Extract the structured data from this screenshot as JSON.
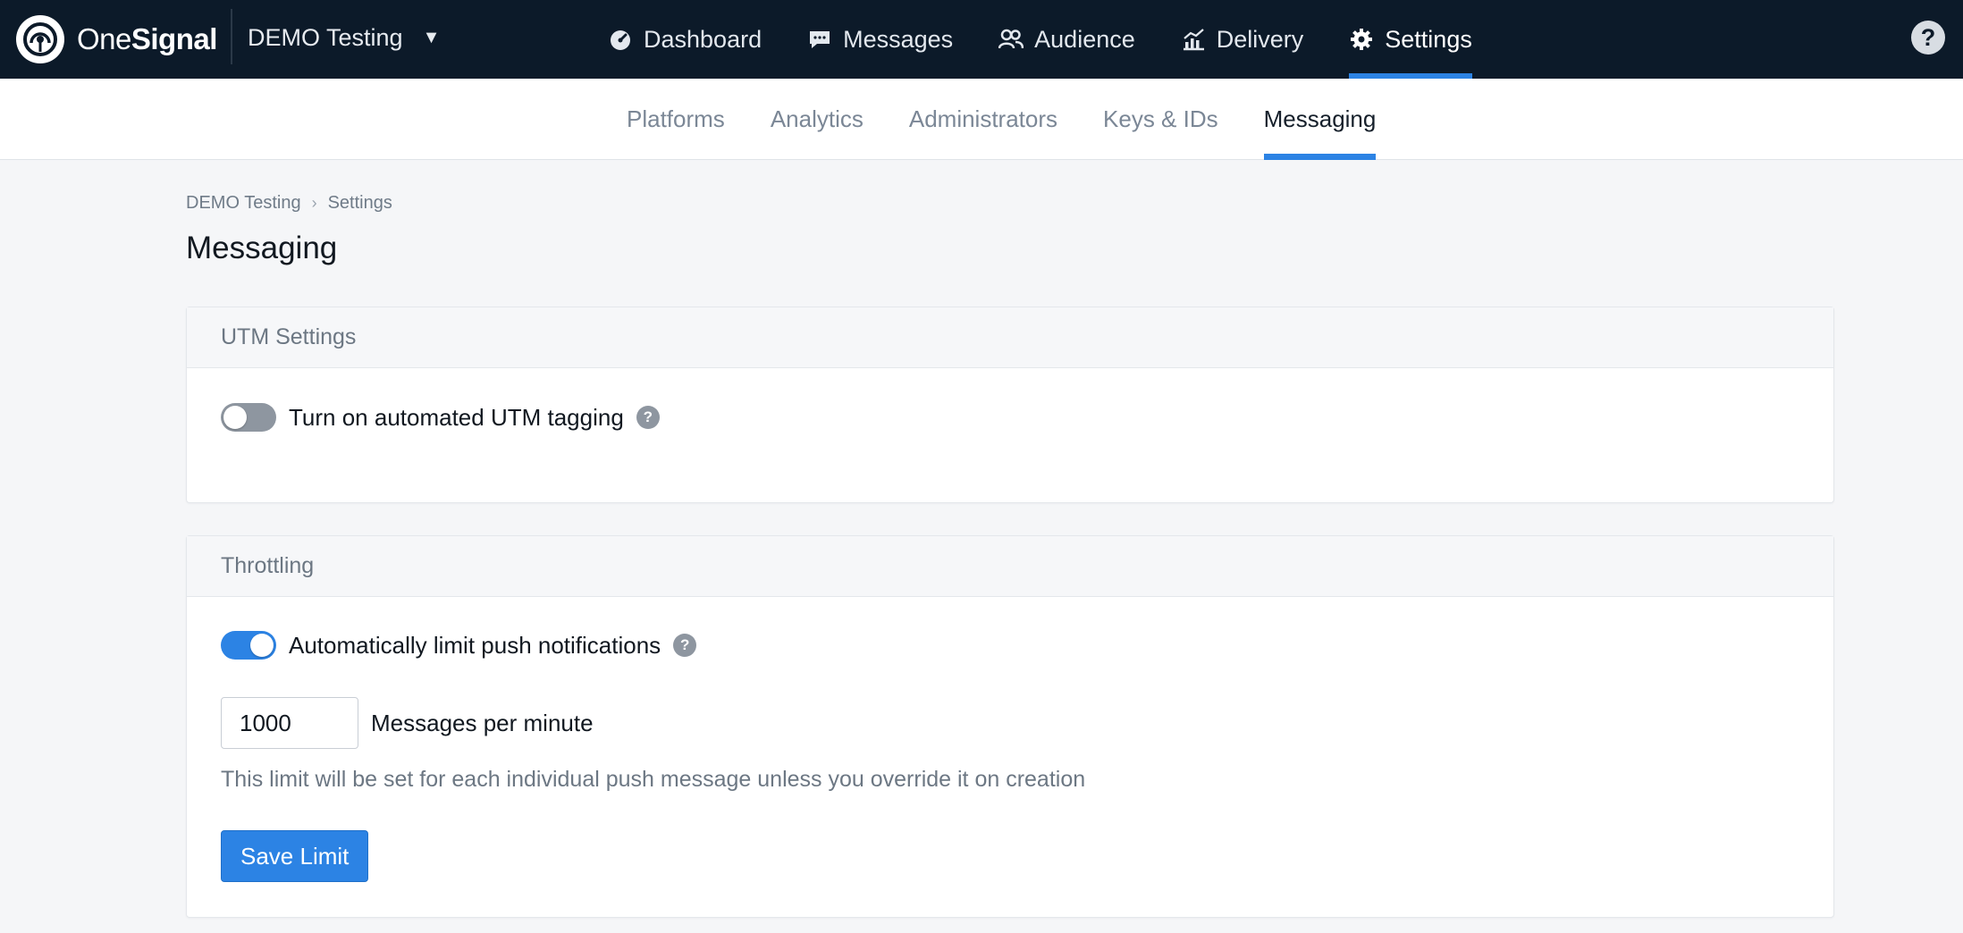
{
  "brand": {
    "name_part1": "One",
    "name_part2": "Signal",
    "logo_icon": "onesignal-logo-icon"
  },
  "app_switcher": {
    "label": "DEMO Testing",
    "caret": "▼"
  },
  "main_nav": {
    "items": [
      {
        "label": "Dashboard",
        "icon": "gauge-icon",
        "active": false
      },
      {
        "label": "Messages",
        "icon": "chat-bubble-icon",
        "active": false
      },
      {
        "label": "Audience",
        "icon": "users-icon",
        "active": false
      },
      {
        "label": "Delivery",
        "icon": "chart-icon",
        "active": false
      },
      {
        "label": "Settings",
        "icon": "gear-icon",
        "active": true
      }
    ]
  },
  "help": {
    "label": "?"
  },
  "sub_nav": {
    "items": [
      {
        "label": "Platforms",
        "active": false
      },
      {
        "label": "Analytics",
        "active": false
      },
      {
        "label": "Administrators",
        "active": false
      },
      {
        "label": "Keys & IDs",
        "active": false
      },
      {
        "label": "Messaging",
        "active": true
      }
    ]
  },
  "breadcrumb": {
    "items": [
      "DEMO Testing",
      "Settings"
    ],
    "separator": "›"
  },
  "page": {
    "title": "Messaging"
  },
  "utm_card": {
    "title": "UTM Settings",
    "toggle_label": "Turn on automated UTM tagging",
    "toggle_on": false,
    "help": "?"
  },
  "throttle_card": {
    "title": "Throttling",
    "toggle_label": "Automatically limit push notifications",
    "toggle_on": true,
    "help": "?",
    "limit_value": "1000",
    "limit_unit": "Messages per minute",
    "help_text": "This limit will be set for each individual push message unless you override it on creation",
    "save_label": "Save Limit"
  },
  "colors": {
    "topnav_bg": "#0c1a29",
    "accent": "#2c83e4",
    "page_bg": "#f5f6f8"
  }
}
